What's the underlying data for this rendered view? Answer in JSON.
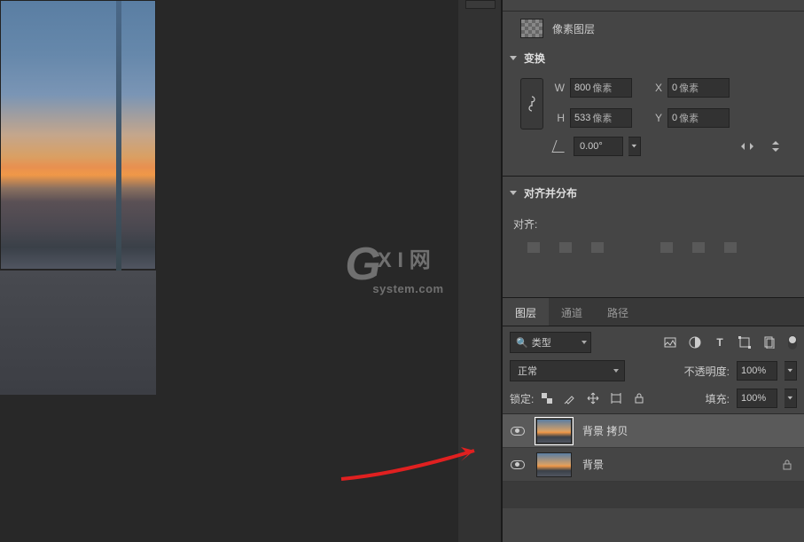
{
  "watermark": {
    "g": "G",
    "xi": "X I 网",
    "sub": "system.com"
  },
  "properties": {
    "pixel_layer_label": "像素图层",
    "transform": {
      "title": "变换",
      "w_label": "W",
      "w_value": "800",
      "w_unit": "像素",
      "x_label": "X",
      "x_value": "0",
      "x_unit": "像素",
      "h_label": "H",
      "h_value": "533",
      "h_unit": "像素",
      "y_label": "Y",
      "y_value": "0",
      "y_unit": "像素",
      "angle_value": "0.00°"
    },
    "align": {
      "title": "对齐并分布",
      "label": "对齐:"
    }
  },
  "layers": {
    "tabs": {
      "layers": "图层",
      "channels": "通道",
      "paths": "路径"
    },
    "filter": {
      "type_label": "类型"
    },
    "blend": {
      "mode": "正常",
      "opacity_label": "不透明度:",
      "opacity_value": "100%"
    },
    "lock": {
      "label": "锁定:",
      "fill_label": "填充:",
      "fill_value": "100%"
    },
    "items": [
      {
        "name": "背景 拷贝",
        "locked": false
      },
      {
        "name": "背景",
        "locked": true
      }
    ]
  }
}
